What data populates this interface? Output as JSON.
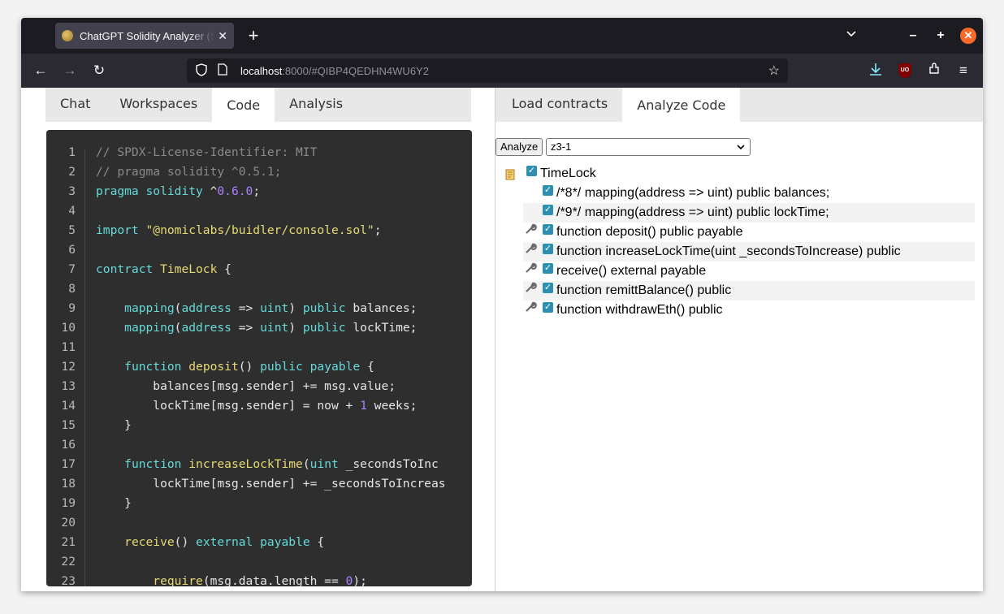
{
  "browser": {
    "tab_title": "ChatGPT Solidity Analyzer (S",
    "url_host": "localhost",
    "url_rest": ":8000/#QIBP4QEDHN4WU6Y2"
  },
  "left": {
    "tabs": [
      "Chat",
      "Workspaces",
      "Code",
      "Analysis"
    ],
    "active_tab": "Code"
  },
  "code": {
    "lines": [
      {
        "n": "1",
        "t": "// SPDX-License-Identifier: MIT"
      },
      {
        "n": "2",
        "t": "// pragma solidity ^0.5.1;"
      },
      {
        "n": "3",
        "t": "pragma solidity ^0.6.0;"
      },
      {
        "n": "4",
        "t": ""
      },
      {
        "n": "5",
        "t": "import \"@nomiclabs/buidler/console.sol\";"
      },
      {
        "n": "6",
        "t": ""
      },
      {
        "n": "7",
        "t": "contract TimeLock {"
      },
      {
        "n": "8",
        "t": ""
      },
      {
        "n": "9",
        "t": "    mapping(address => uint) public balances;"
      },
      {
        "n": "10",
        "t": "    mapping(address => uint) public lockTime;"
      },
      {
        "n": "11",
        "t": ""
      },
      {
        "n": "12",
        "t": "    function deposit() public payable {"
      },
      {
        "n": "13",
        "t": "        balances[msg.sender] += msg.value;"
      },
      {
        "n": "14",
        "t": "        lockTime[msg.sender] = now + 1 weeks;"
      },
      {
        "n": "15",
        "t": "    }"
      },
      {
        "n": "16",
        "t": ""
      },
      {
        "n": "17",
        "t": "    function increaseLockTime(uint _secondsToInc"
      },
      {
        "n": "18",
        "t": "        lockTime[msg.sender] += _secondsToIncreas"
      },
      {
        "n": "19",
        "t": "    }"
      },
      {
        "n": "20",
        "t": ""
      },
      {
        "n": "21",
        "t": "    receive() external payable {"
      },
      {
        "n": "22",
        "t": ""
      },
      {
        "n": "23",
        "t": "        require(msg.data.length == 0);"
      }
    ]
  },
  "right": {
    "tabs": [
      "Load contracts",
      "Analyze Code"
    ],
    "active_tab": "Analyze Code",
    "analyze_button": "Analyze",
    "engine_selected": "z3-1",
    "tree": {
      "root": "TimeLock",
      "items": [
        {
          "label": "/*8*/ mapping(address => uint) public balances;",
          "kind": "state"
        },
        {
          "label": "/*9*/ mapping(address => uint) public lockTime;",
          "kind": "state"
        },
        {
          "label": "function deposit() public payable",
          "kind": "function"
        },
        {
          "label": "function increaseLockTime(uint _secondsToIncrease) public",
          "kind": "function"
        },
        {
          "label": "receive() external payable",
          "kind": "function"
        },
        {
          "label": "function remittBalance() public",
          "kind": "function"
        },
        {
          "label": "function withdrawEth() public",
          "kind": "function"
        }
      ]
    }
  },
  "icons": {
    "tree_root": "contract-scroll-icon",
    "function": "wrench-icon",
    "checkbox": "checked"
  }
}
